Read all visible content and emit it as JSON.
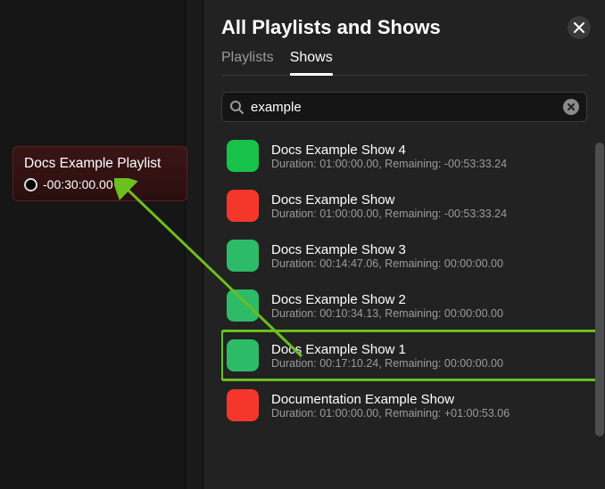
{
  "left": {
    "playlist": {
      "title": "Docs Example Playlist",
      "time": "-00:30:00.00"
    }
  },
  "panel": {
    "title": "All Playlists and Shows",
    "tabs": [
      {
        "label": "Playlists",
        "active": false
      },
      {
        "label": "Shows",
        "active": true
      }
    ]
  },
  "search": {
    "value": "example",
    "placeholder": "Search"
  },
  "shows": [
    {
      "title": "Docs Example Show 4",
      "duration": "01:00:00.00",
      "remaining": "-00:53:33.24",
      "color": "#17c24a",
      "highlight": false
    },
    {
      "title": "Docs Example Show",
      "duration": "01:00:00.00",
      "remaining": "-00:53:33.24",
      "color": "#f5372b",
      "highlight": false
    },
    {
      "title": "Docs Example Show 3",
      "duration": "00:14:47.06",
      "remaining": "00:00:00.00",
      "color": "#2dbb67",
      "highlight": false
    },
    {
      "title": "Docs Example Show 2",
      "duration": "00:10:34.13",
      "remaining": "00:00:00.00",
      "color": "#2dbb67",
      "highlight": false
    },
    {
      "title": "Docs Example Show 1",
      "duration": "00:17:10.24",
      "remaining": "00:00:00.00",
      "color": "#2dbb67",
      "highlight": true
    },
    {
      "title": "Documentation Example Show",
      "duration": "01:00:00.00",
      "remaining": "+01:00:53.06",
      "color": "#f5372b",
      "highlight": false
    }
  ]
}
